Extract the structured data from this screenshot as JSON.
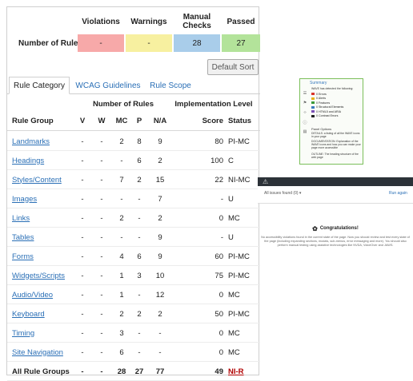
{
  "summary": {
    "headers": {
      "violations": "Violations",
      "warnings": "Warnings",
      "manual_checks": "Manual Checks",
      "passed": "Passed"
    },
    "row_label": "Number of Rules",
    "violations": "-",
    "warnings": "-",
    "manual_checks": "28",
    "passed": "27",
    "colors": {
      "violations": "#f7a9a9",
      "warnings": "#f7f0a0",
      "manual_checks": "#a9cdea",
      "passed": "#b3e39a"
    }
  },
  "toolbar": {
    "default_sort": "Default Sort"
  },
  "tabs": [
    {
      "label": "Rule Category",
      "active": true
    },
    {
      "label": "WCAG Guidelines",
      "active": false
    },
    {
      "label": "Rule Scope",
      "active": false
    }
  ],
  "table": {
    "group_headers": {
      "number_of_rules": "Number of Rules",
      "implementation": "Implementation Level"
    },
    "columns": {
      "name": "Rule Group",
      "v": "V",
      "w": "W",
      "mc": "MC",
      "p": "P",
      "na": "N/A",
      "score": "Score",
      "status": "Status"
    },
    "rows": [
      {
        "name": "Landmarks",
        "v": "-",
        "w": "-",
        "mc": "2",
        "p": "8",
        "na": "9",
        "score": "80",
        "status": "PI-MC"
      },
      {
        "name": "Headings",
        "v": "-",
        "w": "-",
        "mc": "-",
        "p": "6",
        "na": "2",
        "score": "100",
        "status": "C"
      },
      {
        "name": "Styles/Content",
        "v": "-",
        "w": "-",
        "mc": "7",
        "p": "2",
        "na": "15",
        "score": "22",
        "status": "NI-MC"
      },
      {
        "name": "Images",
        "v": "-",
        "w": "-",
        "mc": "-",
        "p": "-",
        "na": "7",
        "score": "-",
        "status": "U"
      },
      {
        "name": "Links",
        "v": "-",
        "w": "-",
        "mc": "2",
        "p": "-",
        "na": "2",
        "score": "0",
        "status": "MC"
      },
      {
        "name": "Tables",
        "v": "-",
        "w": "-",
        "mc": "-",
        "p": "-",
        "na": "9",
        "score": "-",
        "status": "U"
      },
      {
        "name": "Forms",
        "v": "-",
        "w": "-",
        "mc": "4",
        "p": "6",
        "na": "9",
        "score": "60",
        "status": "PI-MC"
      },
      {
        "name": "Widgets/Scripts",
        "v": "-",
        "w": "-",
        "mc": "1",
        "p": "3",
        "na": "10",
        "score": "75",
        "status": "PI-MC"
      },
      {
        "name": "Audio/Video",
        "v": "-",
        "w": "-",
        "mc": "1",
        "p": "-",
        "na": "12",
        "score": "0",
        "status": "MC"
      },
      {
        "name": "Keyboard",
        "v": "-",
        "w": "-",
        "mc": "2",
        "p": "2",
        "na": "2",
        "score": "50",
        "status": "PI-MC"
      },
      {
        "name": "Timing",
        "v": "-",
        "w": "-",
        "mc": "3",
        "p": "-",
        "na": "-",
        "score": "0",
        "status": "MC"
      },
      {
        "name": "Site Navigation",
        "v": "-",
        "w": "-",
        "mc": "6",
        "p": "-",
        "na": "-",
        "score": "0",
        "status": "MC"
      }
    ],
    "total": {
      "name": "All Rule Groups",
      "v": "-",
      "w": "-",
      "mc": "28",
      "p": "27",
      "na": "77",
      "score": "49",
      "status": "NI-R"
    }
  },
  "extension_popup": {
    "title": "Summary",
    "subtitle": "WAVE has detected the following:",
    "items": [
      {
        "label": "0 Errors",
        "color": "#d9342b"
      },
      {
        "label": "0 Alerts",
        "color": "#e8b21a"
      },
      {
        "label": "0 Features",
        "color": "#3a9a3a"
      },
      {
        "label": "0 Structural Elements",
        "color": "#3b7bbf"
      },
      {
        "label": "0 HTML5 and ARIA",
        "color": "#7a4fb5"
      },
      {
        "label": "0 Contrast Errors",
        "color": "#222222"
      }
    ],
    "panel_options_title": "Panel Options",
    "options": [
      "DETAILS: a listing of all the WAVE icons in your page",
      "DOCUMENTATION: Explanation of the WAVE icons and how you can make your page more accessible",
      "OUTLINE: The heading structure of the web page"
    ]
  },
  "checker": {
    "issues_select": "All issues found (0) ▾",
    "run_again": "Run again",
    "congrats_title": "Congratulations!",
    "congrats_message": "No accessibility violations found in the current state of the page. Now you should review and test every state of the page (including expanding sections, modals, sub-menus, error messaging and more). You should also perform manual testing using assistive technologies like NVDA, VoiceOver and JAWS."
  }
}
